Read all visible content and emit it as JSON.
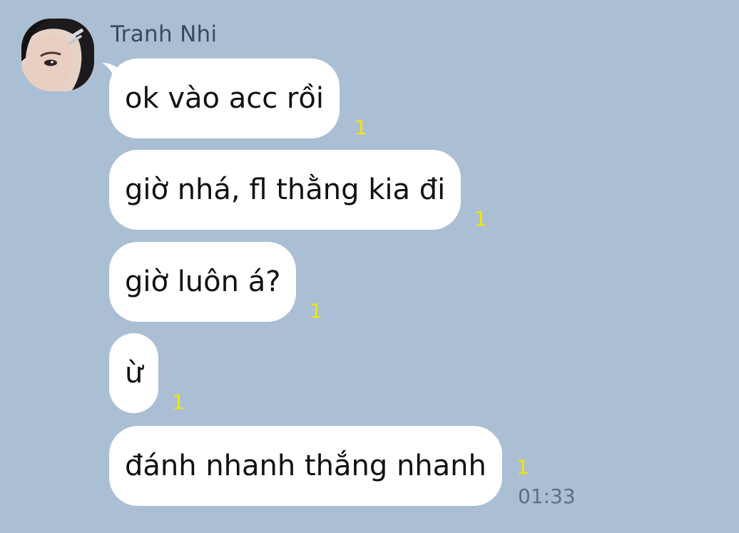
{
  "chat": {
    "sender_name": "Tranh Nhi",
    "messages": [
      {
        "text": "ok vào acc rồi",
        "read_count": "1"
      },
      {
        "text": "giờ nhá, fl thằng kia đi",
        "read_count": "1"
      },
      {
        "text": "giờ luôn á?",
        "read_count": "1"
      },
      {
        "text": "ừ",
        "read_count": "1"
      },
      {
        "text": "đánh nhanh thắng nhanh",
        "read_count": "1",
        "timestamp": "01:33"
      }
    ]
  },
  "colors": {
    "background": "#aabfd3",
    "bubble": "#ffffff",
    "read_count": "#f2e600",
    "timestamp": "#5f6f80",
    "name": "#3b4a5a"
  }
}
